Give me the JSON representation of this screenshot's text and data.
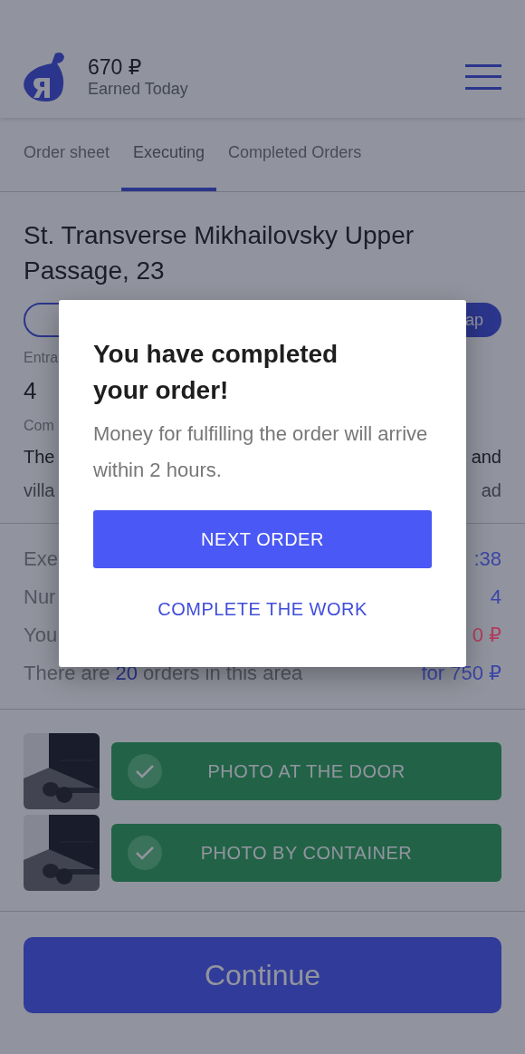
{
  "header": {
    "amount": "670 ₽",
    "caption": "Earned Today"
  },
  "tabs": [
    {
      "label": "Order sheet",
      "selected": false
    },
    {
      "label": "Executing",
      "selected": true
    },
    {
      "label": "Completed Orders",
      "selected": false
    }
  ],
  "order": {
    "address": "St. Transverse Mikhailovsky Upper Passage, 23",
    "buttons": [
      {
        "kind": "outline"
      },
      {
        "kind": "filled",
        "label": "ap"
      }
    ],
    "entrance": {
      "label": "Entra",
      "value": "4"
    },
    "comment": {
      "label": "Com",
      "lines": [
        {
          "left": "The",
          "right": "and"
        },
        {
          "left": "villa",
          "right": "ad"
        }
      ]
    }
  },
  "stats": [
    {
      "label": "Exe",
      "value": ":38",
      "color": "#3c46a6"
    },
    {
      "label": "Nur",
      "value": "4",
      "color": "#3c46a6"
    },
    {
      "label": "You",
      "value": "0 ₽",
      "color": "#b23c5e"
    }
  ],
  "area": {
    "before": "There are ",
    "count": "20",
    "after": " orders in this area",
    "price": "for 750 ₽"
  },
  "photos": [
    {
      "kind": "picture",
      "label": "PHOTO AT THE DOOR",
      "done": true
    },
    {
      "kind": "picture",
      "label": "PHOTO BY CONTAINER",
      "done": true
    }
  ],
  "continue_button": "Continue",
  "dialog": {
    "title": "You have completed your order!",
    "message": "Money for fulfilling the order will arrive within 2 hours.",
    "primary": "NEXT ORDER",
    "secondary": "COMPLETE THE WORK"
  }
}
